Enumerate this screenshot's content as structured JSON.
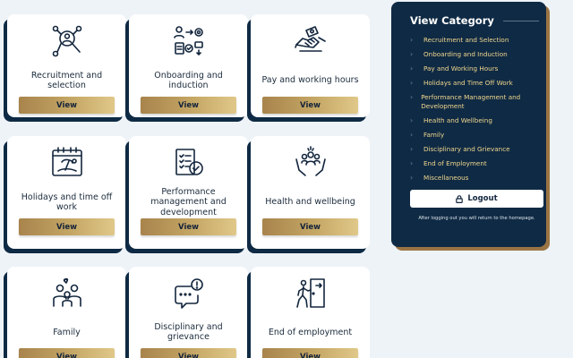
{
  "cards": [
    {
      "title": "Recruitment and selection",
      "button": "View",
      "icon": "recruitment-icon"
    },
    {
      "title": "Onboarding and induction",
      "button": "View",
      "icon": "onboarding-icon"
    },
    {
      "title": "Pay and working hours",
      "button": "View",
      "icon": "pay-icon"
    },
    {
      "title": "Holidays and time off work",
      "button": "View",
      "icon": "holiday-calendar-icon"
    },
    {
      "title": "Performance management and development",
      "button": "View",
      "icon": "performance-checklist-icon"
    },
    {
      "title": "Health and wellbeing",
      "button": "View",
      "icon": "wellbeing-hands-icon"
    },
    {
      "title": "Family",
      "button": "View",
      "icon": "family-icon"
    },
    {
      "title": "Disciplinary and grievance",
      "button": "View",
      "icon": "disciplinary-chat-icon"
    },
    {
      "title": "End of employment",
      "button": "View",
      "icon": "exit-door-icon"
    }
  ],
  "sidebar": {
    "title": "View Category",
    "categories": [
      "Recruitment and Selection",
      "Onboarding and Induction",
      "Pay and Working Hours",
      "Holidays and Time Off Work",
      "Performance Management and Development",
      "Health and Wellbeing",
      "Family",
      "Disciplinary and Grievance",
      "End of Employment",
      "Miscellaneous"
    ],
    "logout_label": "Logout",
    "note": "After logging out you will return to the homepage."
  },
  "colors": {
    "navy": "#0f2a44",
    "gold": "#c5a765",
    "category_text": "#f1d78f",
    "background": "#eef3f8"
  }
}
